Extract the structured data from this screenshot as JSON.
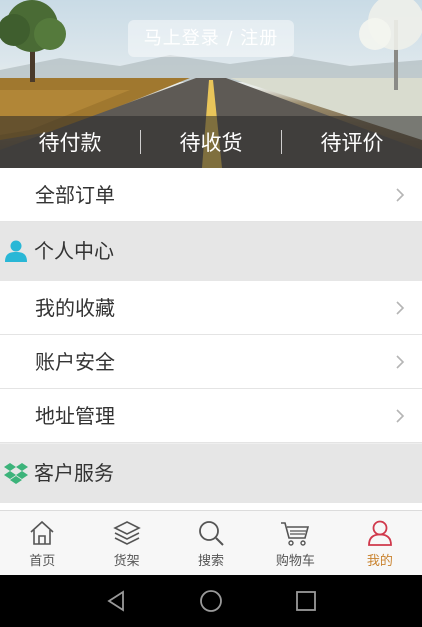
{
  "header": {
    "login_label": "马上登录 / 注册",
    "order_status": [
      {
        "label": "待付款"
      },
      {
        "label": "待收货"
      },
      {
        "label": "待评价"
      }
    ]
  },
  "menu": {
    "all_orders": "全部订单",
    "personal_center": "个人中心",
    "favorites": "我的收藏",
    "account_security": "账户安全",
    "address_management": "地址管理",
    "customer_service": "客户服务"
  },
  "tabbar": {
    "items": [
      {
        "label": "首页",
        "icon": "home-icon"
      },
      {
        "label": "货架",
        "icon": "layers-icon"
      },
      {
        "label": "搜索",
        "icon": "search-icon"
      },
      {
        "label": "购物车",
        "icon": "cart-icon"
      },
      {
        "label": "我的",
        "icon": "user-icon",
        "active": true
      }
    ]
  },
  "colors": {
    "accent": "#c9832f",
    "active_icon": "#d0384b",
    "person_icon": "#29b7d6",
    "service_icon": "#3cb37a"
  },
  "system_nav": {
    "icons": [
      "back-icon",
      "home-circle-icon",
      "recents-icon"
    ]
  }
}
